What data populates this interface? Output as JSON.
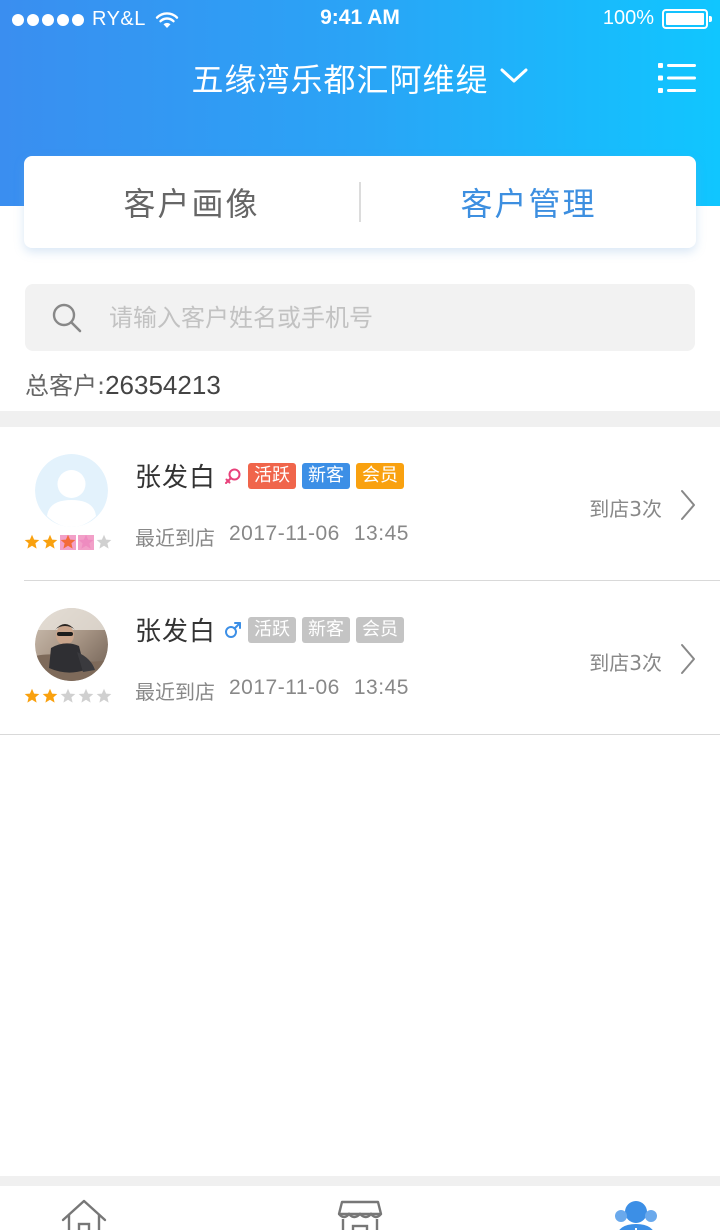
{
  "status_bar": {
    "carrier": "RY&L",
    "time": "9:41 AM",
    "battery": "100%",
    "battery_level": 1.0,
    "signal_bars": 5
  },
  "header": {
    "title": "五缘湾乐都汇阿维缇",
    "dropdown_icon": "chevron-down-icon",
    "menu_icon": "list-menu-icon"
  },
  "tabs": [
    {
      "label": "客户画像",
      "active": false
    },
    {
      "label": "客户管理",
      "active": true
    }
  ],
  "search": {
    "placeholder": "请输入客户姓名或手机号",
    "value": ""
  },
  "summary": {
    "label": "总客户:",
    "value": "26354213"
  },
  "customers": [
    {
      "name": "张发白",
      "gender": "female",
      "gender_color": "#e8417a",
      "avatar": "default-avatar",
      "rating": 2,
      "rating_extra": 2,
      "tags": [
        {
          "label": "活跃",
          "color": "#f0654b"
        },
        {
          "label": "新客",
          "color": "#3c8fe6"
        },
        {
          "label": "会员",
          "color": "#f9a10f"
        }
      ],
      "visit_label": "最近到店",
      "visit_date": "2017-11-06",
      "visit_time": "13:45",
      "visit_count": "到店3次"
    },
    {
      "name": "张发白",
      "gender": "male",
      "gender_color": "#3c8fe6",
      "avatar": "photo-avatar",
      "rating": 2,
      "rating_extra": 0,
      "tags": [
        {
          "label": "活跃",
          "color": "#c4c4c4"
        },
        {
          "label": "新客",
          "color": "#c4c4c4"
        },
        {
          "label": "会员",
          "color": "#c4c4c4"
        }
      ],
      "visit_label": "最近到店",
      "visit_date": "2017-11-06",
      "visit_time": "13:45",
      "visit_count": "到店3次"
    }
  ],
  "colors": {
    "header_start": "#3a8ef0",
    "header_end": "#10c6ff",
    "active_tab": "#3d8fe0",
    "star_gold": "#f9a10f",
    "star_pink": "#f2a0c8",
    "star_empty": "#d0d0d0"
  },
  "tab_bar": {
    "items": [
      {
        "icon": "home-icon",
        "active": false
      },
      {
        "icon": "store-icon",
        "active": false
      },
      {
        "icon": "customers-icon",
        "active": true
      }
    ]
  }
}
